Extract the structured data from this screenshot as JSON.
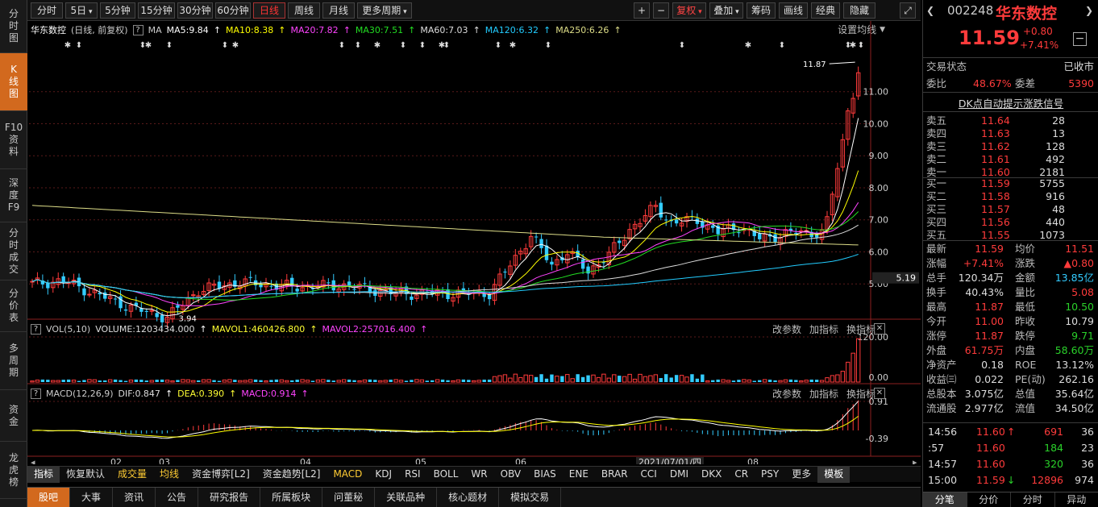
{
  "leftnav": [
    {
      "label": "分时图",
      "active": false
    },
    {
      "label": "K线图",
      "active": true
    },
    {
      "label": "F10资料",
      "active": false
    },
    {
      "label": "深度F9",
      "active": false
    },
    {
      "label": "分时成交",
      "active": false
    },
    {
      "label": "分价表",
      "active": false
    },
    {
      "label": "多周期",
      "active": false
    },
    {
      "label": "资金",
      "active": false
    },
    {
      "label": "龙虎榜",
      "active": false
    }
  ],
  "toolbar": {
    "periods": [
      "分时",
      "5日",
      "5分钟",
      "15分钟",
      "30分钟",
      "60分钟",
      "日线",
      "周线",
      "月线",
      "更多周期"
    ],
    "right_buttons": [
      "+",
      "−",
      "复权",
      "叠加",
      "筹码",
      "画线",
      "经典",
      "隐藏"
    ]
  },
  "chart": {
    "stock_name": "华东数控",
    "mode": "(日线, 前复权)",
    "ma": [
      {
        "label": "MA5:9.84",
        "color": "#ffffff"
      },
      {
        "label": "MA10:8.38",
        "color": "#ffff00"
      },
      {
        "label": "MA20:7.82",
        "color": "#ff44ff"
      },
      {
        "label": "MA30:7.51",
        "color": "#22dd22"
      },
      {
        "label": "MA60:7.03",
        "color": "#dddddd"
      },
      {
        "label": "MA120:6.32",
        "color": "#22ccff"
      },
      {
        "label": "MA250:6.26",
        "color": "#dddd88"
      }
    ],
    "ma_prefix": "MA",
    "settings_label": "设置均线",
    "high_mark": "11.87",
    "low_mark": "3.94",
    "current_price_tag": "5.19",
    "y_ticks": [
      "11.00",
      "10.00",
      "9.00",
      "8.00",
      "7.00",
      "6.00",
      "5.00"
    ],
    "months": [
      "02",
      "03",
      "04",
      "05",
      "06",
      "08"
    ],
    "cursor_date": "2021/07/01/四"
  },
  "vol_panel": {
    "label": "VOL(5,10)",
    "volume": "VOLUME:1203434.000",
    "mavol1": "MAVOL1:460426.800",
    "mavol2": "MAVOL2:257016.400",
    "y_top": "120.00",
    "y_bottom": "0.00",
    "tools": [
      "改参数",
      "加指标",
      "换指标"
    ]
  },
  "macd_panel": {
    "label": "MACD(12,26,9)",
    "dif": "DIF:0.847",
    "dea": "DEA:0.390",
    "macd": "MACD:0.914",
    "y_top": "0.91",
    "y_bottom": "-0.39",
    "tools": [
      "改参数",
      "加指标",
      "换指标"
    ]
  },
  "indicator_tabs": [
    "指标",
    "恢复默认",
    "成交量",
    "均线",
    "资金博弈[L2]",
    "资金趋势[L2]",
    "MACD",
    "KDJ",
    "RSI",
    "BOLL",
    "WR",
    "OBV",
    "BIAS",
    "ENE",
    "BRAR",
    "CCI",
    "DMI",
    "DKX",
    "CR",
    "PSY",
    "更多",
    "模板"
  ],
  "bottom_nav": [
    "股吧",
    "大事",
    "资讯",
    "公告",
    "研究报告",
    "所属板块",
    "问董秘",
    "关联品种",
    "核心题材",
    "模拟交易"
  ],
  "quote": {
    "code": "002248",
    "name": "华东数控",
    "price": "11.59",
    "change": "+0.80",
    "change_pct": "+7.41%",
    "status_label": "交易状态",
    "status_value": "已收市",
    "weibi_label": "委比",
    "weibi": "48.67%",
    "weicha_label": "委差",
    "weicha": "5390",
    "dk_signal": "DK点自动提示涨跌信号",
    "asks": [
      {
        "label": "卖五",
        "price": "11.64",
        "vol": "28"
      },
      {
        "label": "卖四",
        "price": "11.63",
        "vol": "13"
      },
      {
        "label": "卖三",
        "price": "11.62",
        "vol": "128"
      },
      {
        "label": "卖二",
        "price": "11.61",
        "vol": "492"
      },
      {
        "label": "卖一",
        "price": "11.60",
        "vol": "2181"
      }
    ],
    "bids": [
      {
        "label": "买一",
        "price": "11.59",
        "vol": "5755"
      },
      {
        "label": "买二",
        "price": "11.58",
        "vol": "916"
      },
      {
        "label": "买三",
        "price": "11.57",
        "vol": "48"
      },
      {
        "label": "买四",
        "price": "11.56",
        "vol": "440"
      },
      {
        "label": "买五",
        "price": "11.55",
        "vol": "1073"
      }
    ],
    "stats": [
      {
        "l1": "最新",
        "v1": "11.59",
        "c1": "red",
        "l2": "均价",
        "v2": "11.51",
        "c2": "red"
      },
      {
        "l1": "涨幅",
        "v1": "+7.41%",
        "c1": "red",
        "l2": "涨跌",
        "v2": "▲0.80",
        "c2": "red"
      },
      {
        "l1": "总手",
        "v1": "120.34万",
        "c1": "white",
        "l2": "金额",
        "v2": "13.85亿",
        "c2": "cyan"
      },
      {
        "l1": "换手",
        "v1": "40.43%",
        "c1": "white",
        "l2": "量比",
        "v2": "5.08",
        "c2": "red"
      },
      {
        "l1": "最高",
        "v1": "11.87",
        "c1": "red",
        "l2": "最低",
        "v2": "10.50",
        "c2": "green"
      },
      {
        "l1": "今开",
        "v1": "11.00",
        "c1": "red",
        "l2": "昨收",
        "v2": "10.79",
        "c2": "white"
      },
      {
        "l1": "涨停",
        "v1": "11.87",
        "c1": "red",
        "l2": "跌停",
        "v2": "9.71",
        "c2": "green"
      },
      {
        "l1": "外盘",
        "v1": "61.75万",
        "c1": "red",
        "l2": "内盘",
        "v2": "58.60万",
        "c2": "green"
      },
      {
        "l1": "净资产",
        "v1": "0.18",
        "c1": "white",
        "l2": "ROE",
        "v2": "13.12%",
        "c2": "white"
      },
      {
        "l1": "收益㈢",
        "v1": "0.022",
        "c1": "white",
        "l2": "PE(动)",
        "v2": "262.16",
        "c2": "white"
      },
      {
        "l1": "总股本",
        "v1": "3.075亿",
        "c1": "white",
        "l2": "总值",
        "v2": "35.64亿",
        "c2": "white"
      },
      {
        "l1": "流通股",
        "v1": "2.977亿",
        "c1": "white",
        "l2": "流值",
        "v2": "34.50亿",
        "c2": "white"
      }
    ],
    "ticks": [
      {
        "time": "14:56",
        "price": "11.60",
        "arrow": "↑",
        "vol": "691",
        "vcolor": "red",
        "count": "36"
      },
      {
        "time": ":57",
        "price": "11.60",
        "arrow": "",
        "vol": "184",
        "vcolor": "green",
        "count": "23"
      },
      {
        "time": "14:57",
        "price": "11.60",
        "arrow": "",
        "vol": "320",
        "vcolor": "green",
        "count": "36"
      },
      {
        "time": "15:00",
        "price": "11.59",
        "arrow": "↓",
        "vol": "12896",
        "vcolor": "red",
        "count": "974"
      }
    ],
    "tabs": [
      "分笔",
      "分价",
      "分时",
      "异动"
    ]
  },
  "colors": {
    "up": "#ff3b3b",
    "down": "#33ccff",
    "accent": "#d2691e"
  }
}
